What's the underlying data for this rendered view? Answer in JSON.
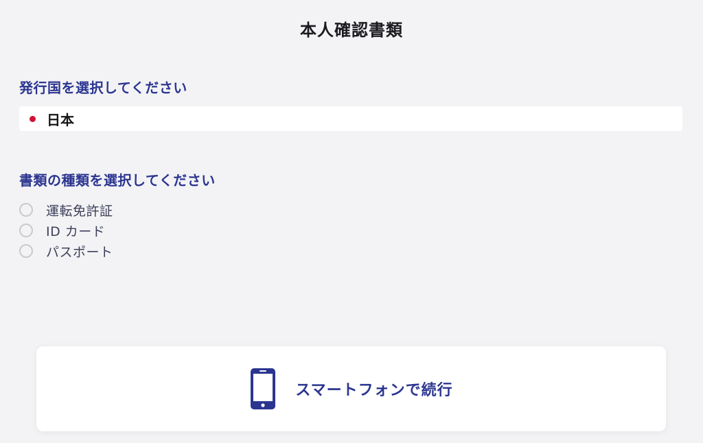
{
  "header": {
    "title": "本人確認書類"
  },
  "country": {
    "label": "発行国を選択してください",
    "selected": "日本",
    "flag_icon": "japan-flag-icon"
  },
  "document": {
    "label": "書類の種類を選択してください",
    "options": [
      {
        "label": "運転免許証",
        "selected": false
      },
      {
        "label": "ID カード",
        "selected": false
      },
      {
        "label": "パスポート",
        "selected": false
      }
    ]
  },
  "continue": {
    "label": "スマートフォンで続行",
    "icon": "smartphone-icon"
  },
  "colors": {
    "accent": "#2b3590",
    "background": "#f3f3f5",
    "flag_red": "#d21034"
  }
}
